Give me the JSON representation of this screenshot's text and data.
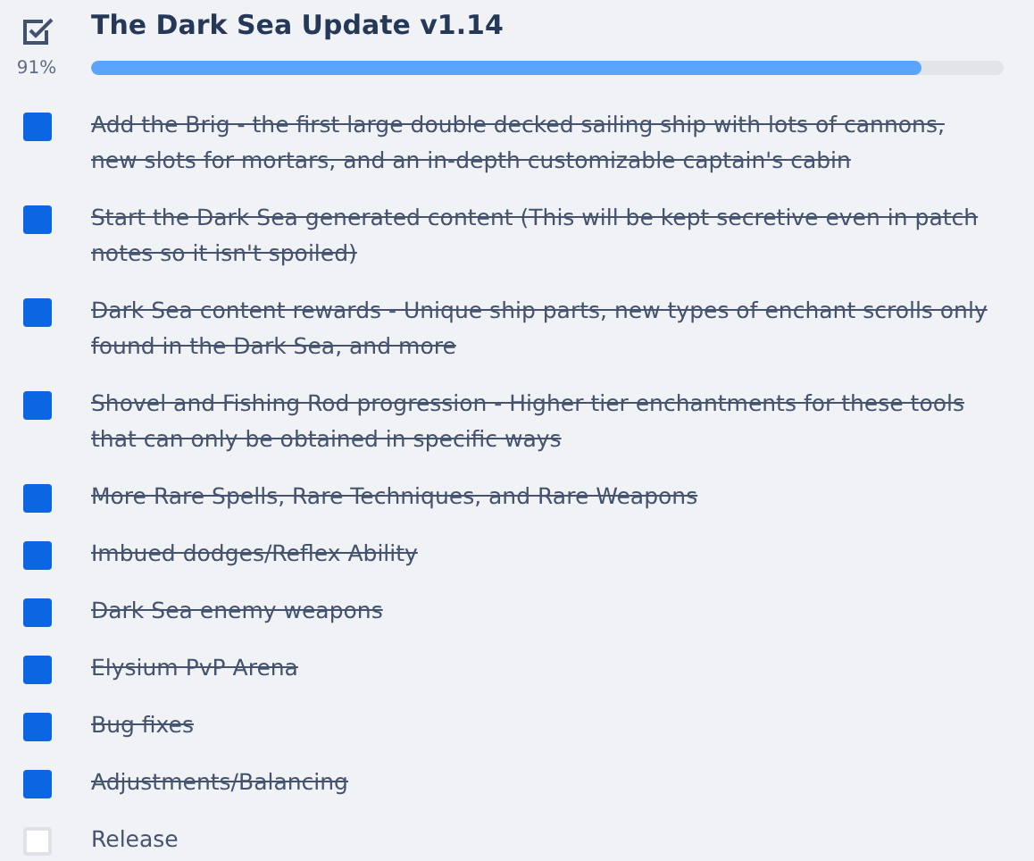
{
  "checklist": {
    "title": "The Dark Sea Update v1.14",
    "percent": "91%",
    "level": 0.91,
    "items": [
      {
        "text": "Add the Brig - the first large double decked sailing ship with lots of cannons, new slots for mortars, and an in-depth customizable captain's cabin",
        "checked": true
      },
      {
        "text": "Start the Dark Sea generated content (This will be kept secretive even in patch notes so it isn't spoiled)",
        "checked": true
      },
      {
        "text": "Dark Sea content rewards - Unique ship parts, new types of enchant scrolls only found in the Dark Sea, and more",
        "checked": true
      },
      {
        "text": "Shovel and Fishing Rod progression - Higher tier enchantments for these tools that can only be obtained in specific ways",
        "checked": true
      },
      {
        "text": "More Rare Spells, Rare Techniques, and Rare Weapons",
        "checked": true
      },
      {
        "text": "Imbued dodges/Reflex Ability",
        "checked": true
      },
      {
        "text": "Dark Sea enemy weapons",
        "checked": true
      },
      {
        "text": "Elysium PvP Arena",
        "checked": true
      },
      {
        "text": "Bug fixes",
        "checked": true
      },
      {
        "text": "Adjustments/Balancing",
        "checked": true
      },
      {
        "text": "Release",
        "checked": false
      }
    ]
  }
}
